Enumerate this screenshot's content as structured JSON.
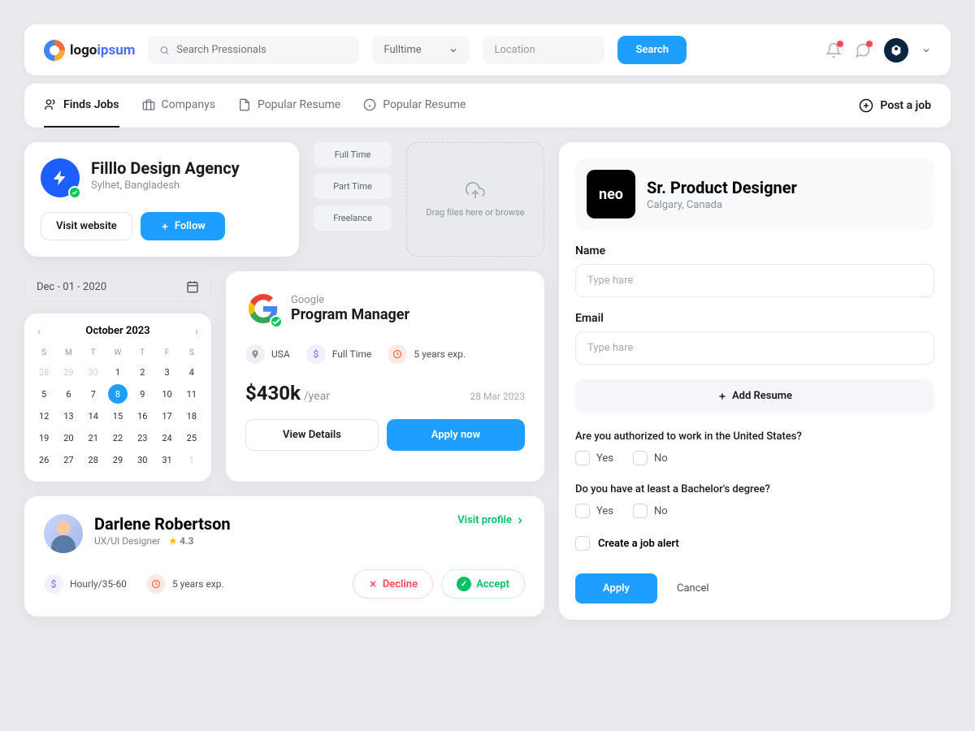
{
  "header": {
    "logo": {
      "t1": "logo",
      "t2": "ipsum"
    },
    "search_ph": "Search Pressionals",
    "select_value": "Fulltime",
    "location_ph": "Location",
    "search_btn": "Search"
  },
  "nav": {
    "items": [
      "Finds Jobs",
      "Companys",
      "Popular Resume",
      "Popular Resume"
    ],
    "post": "Post a job"
  },
  "agency": {
    "name": "Filllo Design Agency",
    "loc": "Sylhet, Bangladesh",
    "visit": "Visit website",
    "follow": "Follow"
  },
  "chips": [
    "Full Time",
    "Part Time",
    "Freelance"
  ],
  "drop": "Drag files here or browse",
  "date": "Dec - 01 - 2020",
  "cal": {
    "title": "October 2023",
    "dow": [
      "S",
      "M",
      "T",
      "W",
      "T",
      "F",
      "S"
    ],
    "prev": [
      28,
      29,
      30
    ],
    "days": [
      1,
      2,
      3,
      4,
      5,
      6,
      7,
      8,
      9,
      10,
      11,
      12,
      13,
      14,
      15,
      16,
      17,
      18,
      19,
      20,
      21,
      22,
      23,
      24,
      25,
      26,
      27,
      28,
      29,
      30,
      31
    ],
    "next": [
      1
    ],
    "selected": 8
  },
  "job": {
    "company": "Google",
    "title": "Program Manager",
    "loc": "USA",
    "type": "Full Time",
    "exp": "5 years exp.",
    "salary": "$430k",
    "per": "/year",
    "posted": "28 Mar 2023",
    "view": "View Details",
    "apply": "Apply now"
  },
  "profile": {
    "name": "Darlene Robertson",
    "role": "UX/UI Designer",
    "rating": "4.3",
    "visit": "Visit profile",
    "rate": "Hourly/35-60",
    "exp": "5 years exp.",
    "decline": "Decline",
    "accept": "Accept"
  },
  "apply": {
    "brand": "neo",
    "title": "Sr. Product Designer",
    "loc": "Calgary, Canada",
    "name_lbl": "Name",
    "email_lbl": "Email",
    "ph": "Type hare",
    "resume": "Add Resume",
    "q1": "Are you authorized to work in the United States?",
    "q2": "Do you have at least a Bachelor's degree?",
    "yes": "Yes",
    "no": "No",
    "alert": "Create a job alert",
    "apply_btn": "Apply",
    "cancel": "Cancel"
  }
}
